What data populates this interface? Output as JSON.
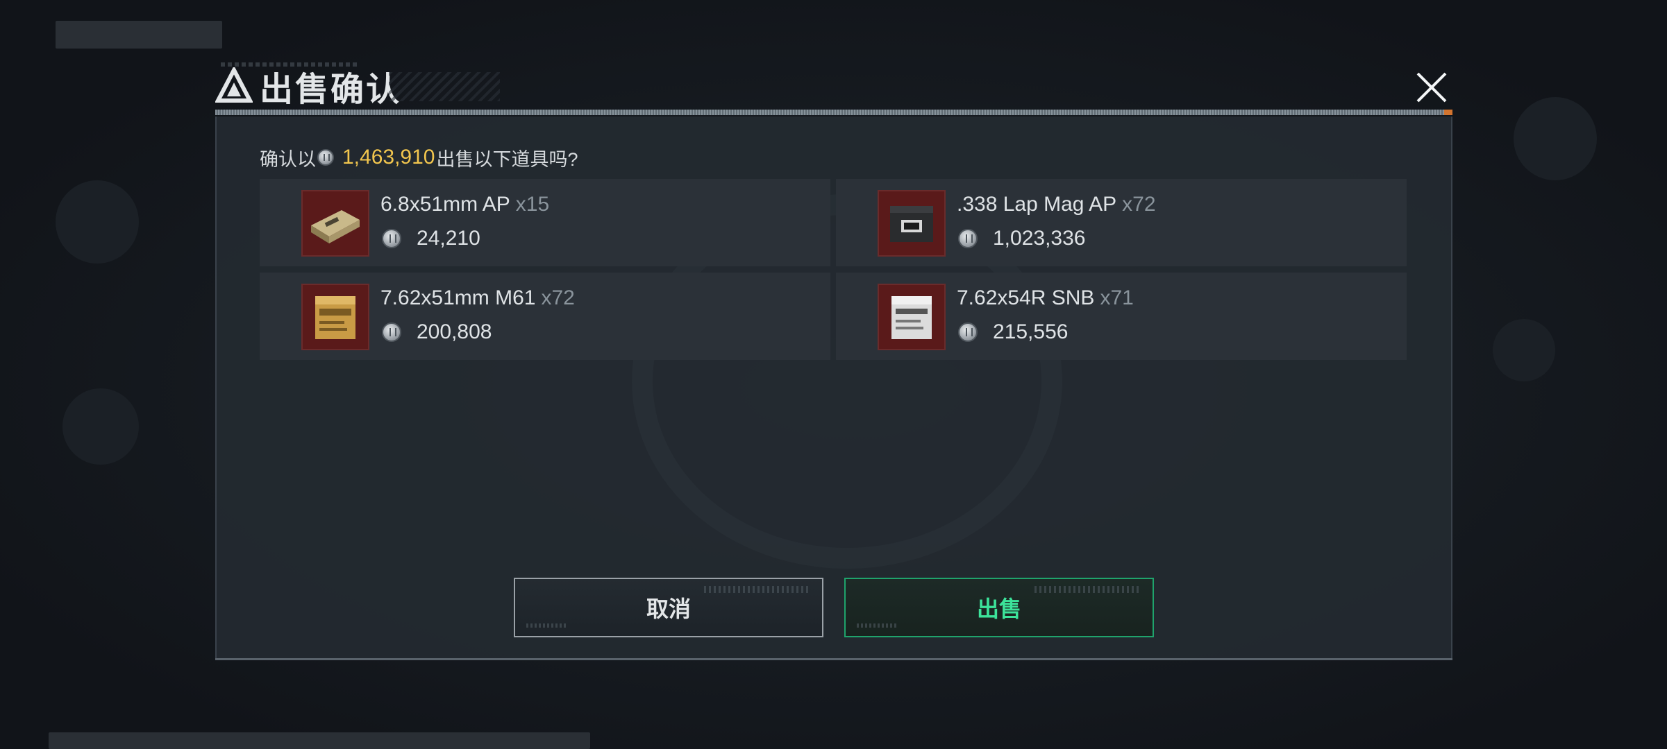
{
  "dialog": {
    "title": "出售确认"
  },
  "prompt": {
    "prefix": "确认以",
    "total": "1,463,910",
    "suffix": "出售以下道具吗?"
  },
  "items": [
    {
      "name": "6.8x51mm AP",
      "qty": "x15",
      "price": "24,210"
    },
    {
      "name": ".338 Lap Mag AP",
      "qty": "x72",
      "price": "1,023,336"
    },
    {
      "name": "7.62x51mm M61",
      "qty": "x72",
      "price": "200,808"
    },
    {
      "name": "7.62x54R SNB",
      "qty": "x71",
      "price": "215,556"
    }
  ],
  "buttons": {
    "cancel": "取消",
    "sell": "出售"
  },
  "colors": {
    "accent_price": "#f2c64e",
    "sell_green": "#3ce39a",
    "item_thumb_bg": "#5a1a1a"
  }
}
